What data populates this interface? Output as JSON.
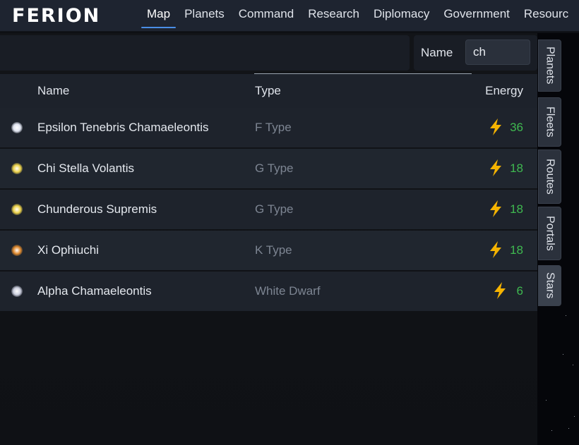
{
  "app": {
    "logo": "FERION"
  },
  "nav": [
    {
      "label": "Map",
      "active": true
    },
    {
      "label": "Planets"
    },
    {
      "label": "Command"
    },
    {
      "label": "Research"
    },
    {
      "label": "Diplomacy"
    },
    {
      "label": "Government"
    },
    {
      "label": "Resourc"
    }
  ],
  "filter": {
    "label": "Name",
    "value": "ch"
  },
  "table": {
    "headers": {
      "name": "Name",
      "type": "Type",
      "energy": "Energy"
    },
    "rows": [
      {
        "name": "Epsilon Tenebris Chamaeleontis",
        "type": "F Type",
        "energy": "36",
        "star_color": "#dfe3ef"
      },
      {
        "name": "Chi Stella Volantis",
        "type": "G Type",
        "energy": "18",
        "star_color": "#ecd24a"
      },
      {
        "name": "Chunderous Supremis",
        "type": "G Type",
        "energy": "18",
        "star_color": "#ecd24a"
      },
      {
        "name": "Xi Ophiuchi",
        "type": "K Type",
        "energy": "18",
        "star_color": "#e08a2e"
      },
      {
        "name": "Alpha Chamaeleontis",
        "type": "White Dwarf",
        "energy": "6",
        "star_color": "#c9ccdc"
      }
    ]
  },
  "side_tabs": [
    {
      "label": "Planets"
    },
    {
      "label": "Fleets"
    },
    {
      "label": "Routes"
    },
    {
      "label": "Portals"
    },
    {
      "label": "Stars",
      "active": true
    }
  ],
  "colors": {
    "accent": "#4a8ee6",
    "energy": "#3fb950",
    "bolt": "#f5b301"
  },
  "icons": {
    "energy": "lightning-bolt-icon",
    "star": "star-dot-icon"
  }
}
